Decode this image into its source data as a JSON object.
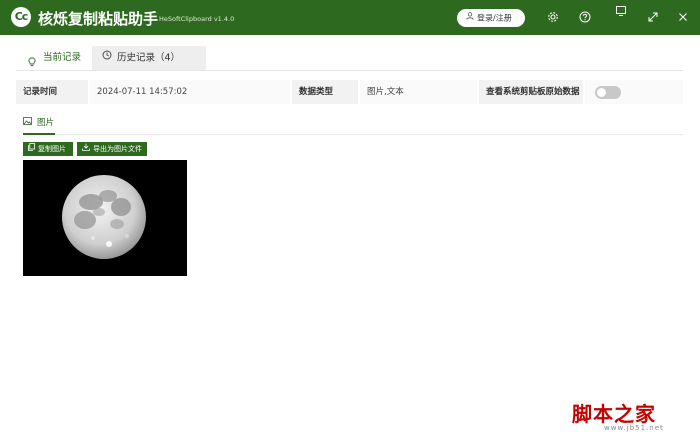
{
  "titlebar": {
    "logo_text": "Cc",
    "app_name": "核烁复制粘贴助手",
    "version": "HeSoftClipboard v1.4.0",
    "login_label": "登录/注册",
    "icons": [
      "settings-icon",
      "help-icon",
      "pin-icon",
      "maximize-icon",
      "close-icon"
    ]
  },
  "tabs": [
    {
      "label": "当前记录",
      "icon": "bulb-icon",
      "active": true
    },
    {
      "label": "历史记录（4）",
      "icon": "history-icon",
      "active": false
    }
  ],
  "info": {
    "time_label": "记录时间",
    "time_value": "2024-07-11 14:57:02",
    "type_label": "数据类型",
    "type_value": "图片,文本",
    "raw_label": "查看系统剪贴板原始数据",
    "raw_toggle_on": false
  },
  "content_tabs": [
    {
      "label": "图片",
      "icon": "image-icon",
      "active": true
    }
  ],
  "actions": {
    "copy_image": "复制图片",
    "export_image": "导出为图片文件"
  },
  "preview": {
    "subject": "full moon photo"
  },
  "watermark": {
    "main_text": "脚本之家",
    "url_text": "www.jb51.net"
  },
  "colors": {
    "brand": "#2d6a1f",
    "watermark_red": "#c40000",
    "watermark_yellow": "#d9a000"
  }
}
